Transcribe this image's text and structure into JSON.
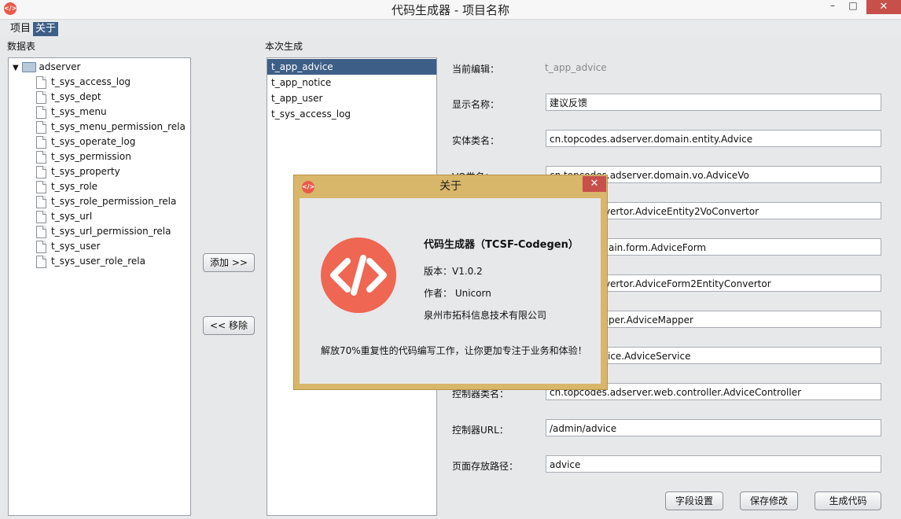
{
  "window": {
    "title": "代码生成器 - 项目名称",
    "minimize": "–",
    "maximize": "□",
    "close": "✕"
  },
  "menu": {
    "items": [
      "项目",
      "关于"
    ],
    "active_index": 1
  },
  "tables_panel": {
    "label": "数据表",
    "root": "adserver",
    "items": [
      "t_sys_access_log",
      "t_sys_dept",
      "t_sys_menu",
      "t_sys_menu_permission_rela",
      "t_sys_operate_log",
      "t_sys_permission",
      "t_sys_property",
      "t_sys_role",
      "t_sys_role_permission_rela",
      "t_sys_url",
      "t_sys_url_permission_rela",
      "t_sys_user",
      "t_sys_user_role_rela"
    ]
  },
  "actions": {
    "add": "添加 >>",
    "remove": "<< 移除"
  },
  "selected_panel": {
    "label": "本次生成",
    "items": [
      "t_app_advice",
      "t_app_notice",
      "t_app_user",
      "t_sys_access_log"
    ],
    "selected_index": 0
  },
  "form": {
    "current_label": "当前编辑：",
    "current_value": "t_app_advice",
    "fields": [
      {
        "label": "显示名称：",
        "value": "建议反馈"
      },
      {
        "label": "实体类名：",
        "value": "cn.topcodes.adserver.domain.entity.Advice"
      },
      {
        "label": "VO类名：",
        "value": "cn.topcodes.adserver.domain.vo.AdviceVo"
      },
      {
        "label": "",
        "value": "dserver.convertor.AdviceEntity2VoConvertor"
      },
      {
        "label": "",
        "value": "dserver.domain.form.AdviceForm"
      },
      {
        "label": "",
        "value": "dserver.convertor.AdviceForm2EntityConvertor"
      },
      {
        "label": "",
        "value": "dserver.mapper.AdviceMapper"
      },
      {
        "label": "",
        "value": "dserver.service.AdviceService"
      },
      {
        "label": "控制器类名：",
        "value": "cn.topcodes.adserver.web.controller.AdviceController"
      },
      {
        "label": "控制器URL：",
        "value": "/admin/advice"
      },
      {
        "label": "页面存放路径：",
        "value": "advice"
      }
    ],
    "buttons": [
      "字段设置",
      "保存修改",
      "生成代码"
    ]
  },
  "about_dialog": {
    "title": "关于",
    "close": "✕",
    "logo_glyph": "</>",
    "app_name": "代码生成器（TCSF-Codegen）",
    "version": "版本：V1.0.2",
    "author": "作者： Unicorn",
    "company": "泉州市拓科信息技术有限公司",
    "slogan": "解放70%重复性的代码编写工作，让你更加专注于业务和体验！"
  },
  "colors": {
    "accent": "#3d5e86",
    "logo": "#ef6652",
    "dialog_frame": "#d8b66a",
    "close": "#c7504b"
  }
}
